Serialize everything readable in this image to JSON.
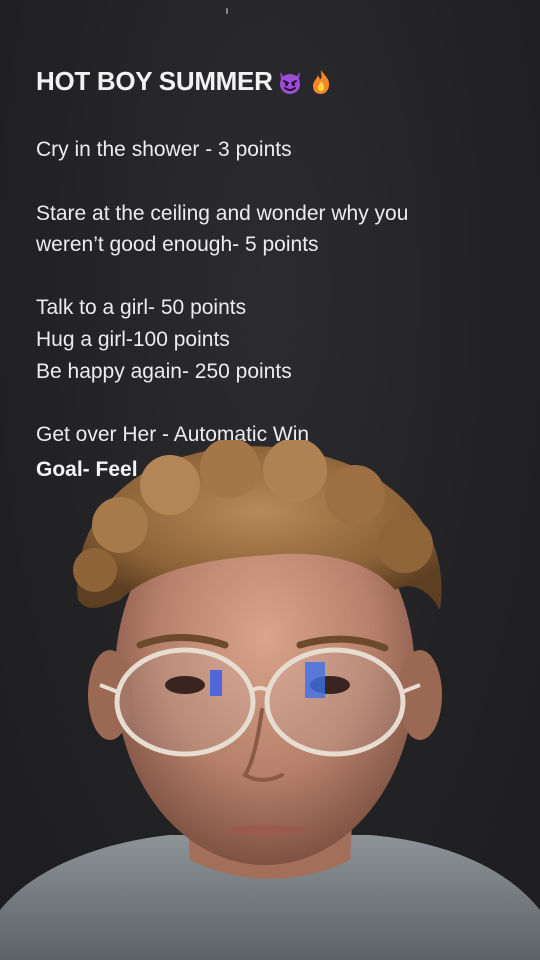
{
  "note": {
    "title": "HOT BOY SUMMER",
    "title_emojis": [
      "devil-face-icon",
      "fire-icon"
    ],
    "lines": [
      "Cry in the shower - 3 points",
      "Stare at the ceiling and wonder why you",
      "weren’t good enough- 5 points",
      "Talk to a girl- 50 points",
      "Hug a girl-100 points",
      "Be happy again- 250 points",
      "Get over Her - Automatic Win"
    ],
    "goal": "Goal- Feel"
  },
  "colors": {
    "background": "#232326",
    "text": "#f2f2f2",
    "devil_purple": "#8e44c9",
    "fire_orange": "#f5852a"
  }
}
